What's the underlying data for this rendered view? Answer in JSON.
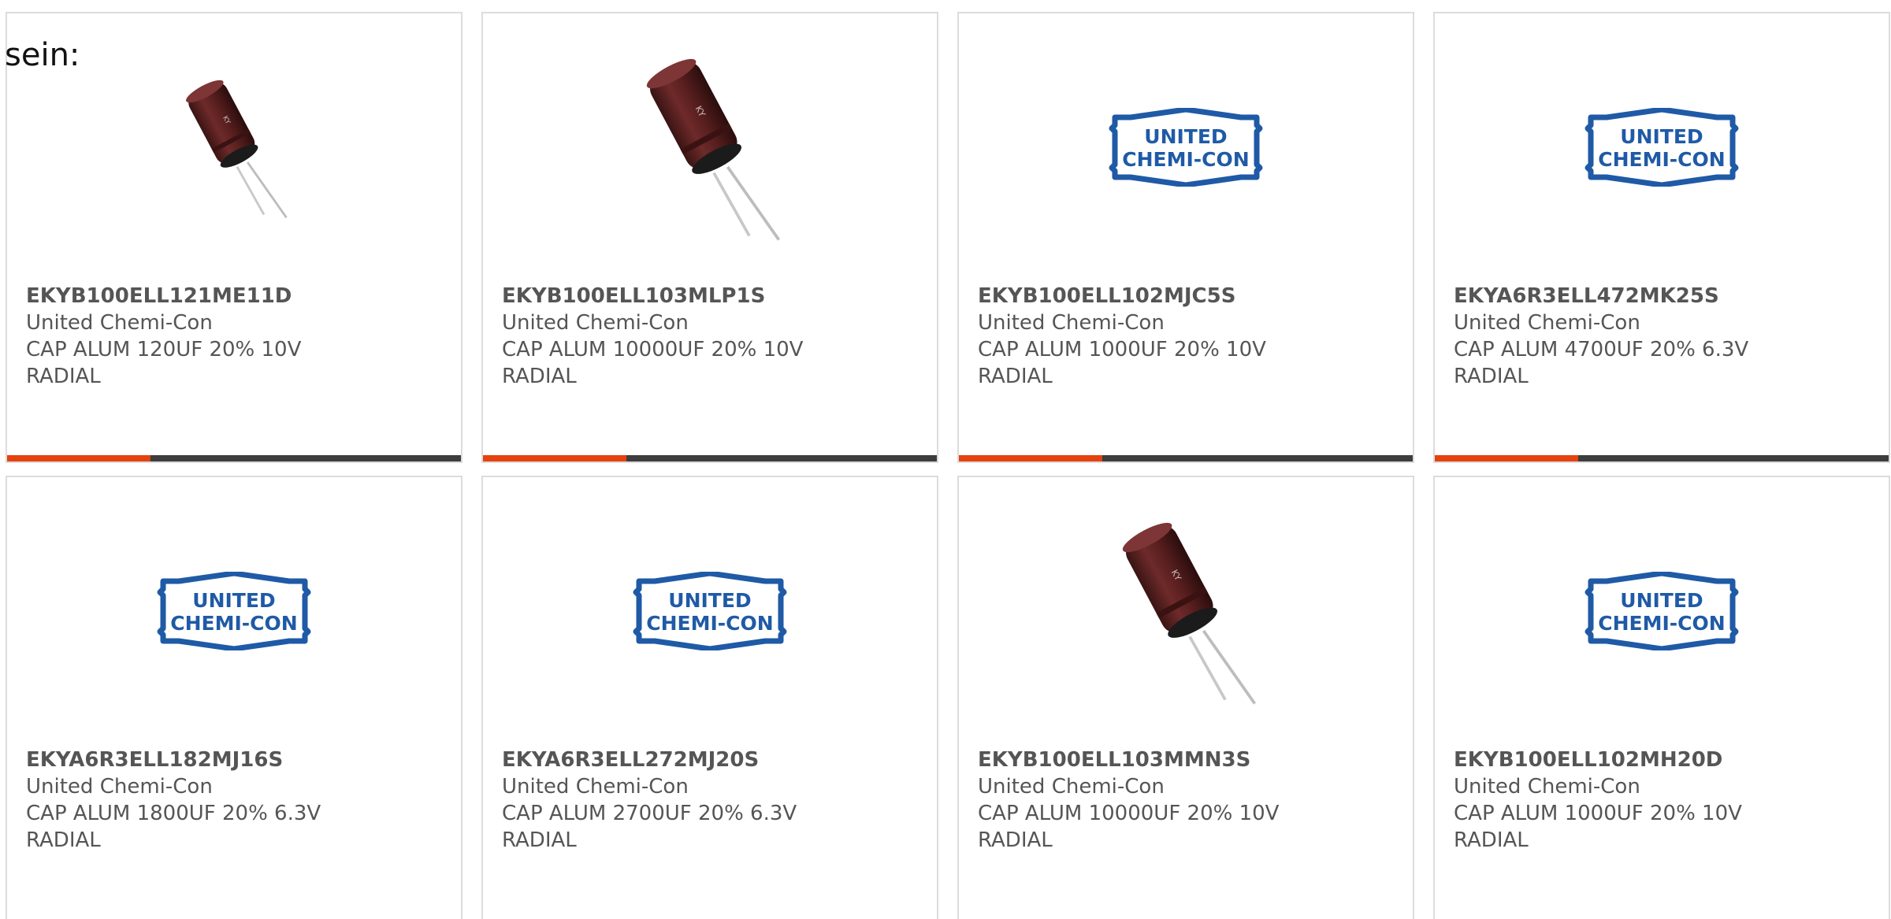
{
  "intro_text": "sein:",
  "colors": {
    "accent": "#e5420f",
    "bar": "#3d3d3d",
    "text": "#555555",
    "logo_blue": "#1f5aa6"
  },
  "logo_lines": [
    "UNITED",
    "CHEMI-CON"
  ],
  "cards": [
    {
      "part_number": "EKYB100ELL121ME11D",
      "manufacturer": "United Chemi-Con",
      "description_line1": "CAP ALUM 120UF 20% 10V",
      "description_line2": "RADIAL",
      "image": "capacitor-small-photo",
      "show_bar": true
    },
    {
      "part_number": "EKYB100ELL103MLP1S",
      "manufacturer": "United Chemi-Con",
      "description_line1": "CAP ALUM 10000UF 20% 10V",
      "description_line2": "RADIAL",
      "image": "capacitor-large-photo",
      "show_bar": true
    },
    {
      "part_number": "EKYB100ELL102MJC5S",
      "manufacturer": "United Chemi-Con",
      "description_line1": "CAP ALUM 1000UF 20% 10V",
      "description_line2": "RADIAL",
      "image": "united-chemi-con-logo",
      "show_bar": true
    },
    {
      "part_number": "EKYA6R3ELL472MK25S",
      "manufacturer": "United Chemi-Con",
      "description_line1": "CAP ALUM 4700UF 20% 6.3V",
      "description_line2": "RADIAL",
      "image": "united-chemi-con-logo",
      "show_bar": true
    },
    {
      "part_number": "EKYA6R3ELL182MJ16S",
      "manufacturer": "United Chemi-Con",
      "description_line1": "CAP ALUM 1800UF 20% 6.3V",
      "description_line2": "RADIAL",
      "image": "united-chemi-con-logo",
      "show_bar": false
    },
    {
      "part_number": "EKYA6R3ELL272MJ20S",
      "manufacturer": "United Chemi-Con",
      "description_line1": "CAP ALUM 2700UF 20% 6.3V",
      "description_line2": "RADIAL",
      "image": "united-chemi-con-logo",
      "show_bar": false
    },
    {
      "part_number": "EKYB100ELL103MMN3S",
      "manufacturer": "United Chemi-Con",
      "description_line1": "CAP ALUM 10000UF 20% 10V",
      "description_line2": "RADIAL",
      "image": "capacitor-large-photo",
      "show_bar": false
    },
    {
      "part_number": "EKYB100ELL102MH20D",
      "manufacturer": "United Chemi-Con",
      "description_line1": "CAP ALUM 1000UF 20% 10V",
      "description_line2": "RADIAL",
      "image": "united-chemi-con-logo",
      "show_bar": false
    }
  ]
}
